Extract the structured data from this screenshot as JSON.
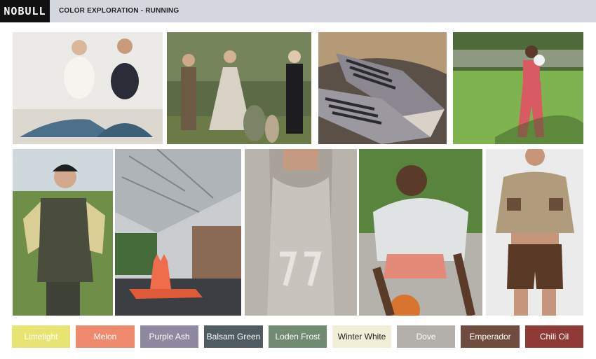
{
  "header": {
    "logo": "NOBULL",
    "title": "COLOR EXPLORATION - RUNNING"
  },
  "photos": [
    {
      "name": "photo-two-women-activewear"
    },
    {
      "name": "photo-period-costume-group"
    },
    {
      "name": "photo-grey-sneakers"
    },
    {
      "name": "photo-boxer-in-field"
    },
    {
      "name": "photo-man-in-utility-vest"
    },
    {
      "name": "photo-glass-architecture"
    },
    {
      "name": "photo-knit-tank-77"
    },
    {
      "name": "photo-basketball-player"
    },
    {
      "name": "photo-cropped-pullover-shorts"
    }
  ],
  "swatches": [
    {
      "label": "Limelight",
      "bg": "#e8e472",
      "fg": "#ffffff"
    },
    {
      "label": "Melon",
      "bg": "#ef8a6c",
      "fg": "#ffffff"
    },
    {
      "label": "Purple Ash",
      "bg": "#8e88a0",
      "fg": "#ffffff"
    },
    {
      "label": "Balsam Green",
      "bg": "#4f5c61",
      "fg": "#ffffff"
    },
    {
      "label": "Loden Frost",
      "bg": "#718a72",
      "fg": "#ffffff"
    },
    {
      "label": "Winter White",
      "bg": "#f2efd9",
      "fg": "#222222"
    },
    {
      "label": "Dove",
      "bg": "#b3afab",
      "fg": "#ffffff"
    },
    {
      "label": "Emperador",
      "bg": "#6f4c3d",
      "fg": "#ffffff"
    },
    {
      "label": "Chili Oil",
      "bg": "#8f3a35",
      "fg": "#ffffff"
    }
  ]
}
